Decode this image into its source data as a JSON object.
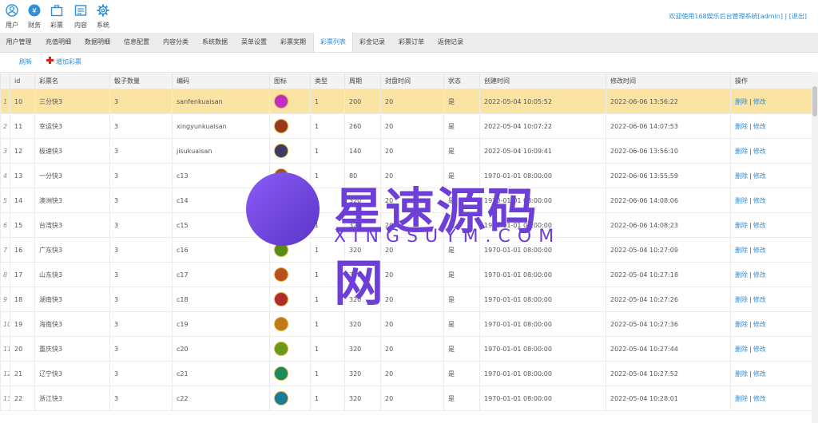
{
  "top_nav": [
    {
      "label": "用户",
      "icon": "user-icon"
    },
    {
      "label": "财务",
      "icon": "yen-icon"
    },
    {
      "label": "彩票",
      "icon": "briefcase-icon"
    },
    {
      "label": "内容",
      "icon": "document-icon"
    },
    {
      "label": "系统",
      "icon": "gear-icon"
    }
  ],
  "header": {
    "welcome": "欢迎使用168娱乐后台管理系统[admin]",
    "separator": "|",
    "logout": "[退出]"
  },
  "tabs": [
    "用户管理",
    "充值明细",
    "数据明细",
    "信息配置",
    "内容分类",
    "系统数据",
    "菜单设置",
    "彩票奖期",
    "彩票列表",
    "彩金记录",
    "彩票订单",
    "返佣记录"
  ],
  "active_tab": "彩票列表",
  "toolbar": {
    "refresh": "刷新",
    "add": "增加彩票"
  },
  "table": {
    "headers": [
      "",
      "id",
      "彩票名",
      "骰子数量",
      "编码",
      "图标",
      "类型",
      "周期",
      "封盘时间",
      "状态",
      "创建时间",
      "修改时间",
      "操作"
    ],
    "actions": {
      "delete": "删除",
      "sep": "|",
      "edit": "修改"
    },
    "rows": [
      {
        "n": "1",
        "id": "10",
        "name": "三分快3",
        "dice": "3",
        "code": "sanfenkuaisan",
        "type": "1",
        "period": "200",
        "close": "20",
        "status": "是",
        "created": "2022-05-04 10:05:52",
        "modified": "2022-06-06 13:56:22",
        "badge": "#c02fbf"
      },
      {
        "n": "2",
        "id": "11",
        "name": "幸运快3",
        "dice": "3",
        "code": "xingyunkuaisan",
        "type": "1",
        "period": "260",
        "close": "20",
        "status": "是",
        "created": "2022-05-04 10:07:22",
        "modified": "2022-06-06 14:07:53",
        "badge": "#9a3a1a"
      },
      {
        "n": "3",
        "id": "12",
        "name": "极速快3",
        "dice": "3",
        "code": "jisukuaisan",
        "type": "1",
        "period": "140",
        "close": "20",
        "status": "是",
        "created": "2022-05-04 10:09:41",
        "modified": "2022-06-06 13:56:10",
        "badge": "#3d3a66"
      },
      {
        "n": "4",
        "id": "13",
        "name": "一分快3",
        "dice": "3",
        "code": "c13",
        "type": "1",
        "period": "80",
        "close": "20",
        "status": "是",
        "created": "1970-01-01 08:00:00",
        "modified": "2022-06-06 13:55:59",
        "badge": "#a0521a"
      },
      {
        "n": "5",
        "id": "14",
        "name": "澳洲快3",
        "dice": "3",
        "code": "c14",
        "type": "1",
        "period": "320",
        "close": "20",
        "status": "是",
        "created": "1970-01-01 08:00:00",
        "modified": "2022-06-06 14:08:06",
        "badge": "#2a6a8a"
      },
      {
        "n": "6",
        "id": "15",
        "name": "台湾快3",
        "dice": "3",
        "code": "c15",
        "type": "1",
        "period": "320",
        "close": "20",
        "status": "是",
        "created": "1970-01-01 08:00:00",
        "modified": "2022-06-06 14:08:23",
        "badge": "#1a6a4a"
      },
      {
        "n": "7",
        "id": "16",
        "name": "广东快3",
        "dice": "3",
        "code": "c16",
        "type": "1",
        "period": "320",
        "close": "20",
        "status": "是",
        "created": "1970-01-01 08:00:00",
        "modified": "2022-05-04 10:27:09",
        "badge": "#5a8a1a"
      },
      {
        "n": "8",
        "id": "17",
        "name": "山东快3",
        "dice": "3",
        "code": "c17",
        "type": "1",
        "period": "320",
        "close": "20",
        "status": "是",
        "created": "1970-01-01 08:00:00",
        "modified": "2022-05-04 10:27:18",
        "badge": "#b8501a"
      },
      {
        "n": "9",
        "id": "18",
        "name": "湖南快3",
        "dice": "3",
        "code": "c18",
        "type": "1",
        "period": "320",
        "close": "20",
        "status": "是",
        "created": "1970-01-01 08:00:00",
        "modified": "2022-05-04 10:27:26",
        "badge": "#b02a2a"
      },
      {
        "n": "10",
        "id": "19",
        "name": "海南快3",
        "dice": "3",
        "code": "c19",
        "type": "1",
        "period": "320",
        "close": "20",
        "status": "是",
        "created": "1970-01-01 08:00:00",
        "modified": "2022-05-04 10:27:36",
        "badge": "#c07a1a"
      },
      {
        "n": "11",
        "id": "20",
        "name": "重庆快3",
        "dice": "3",
        "code": "c20",
        "type": "1",
        "period": "320",
        "close": "20",
        "status": "是",
        "created": "1970-01-01 08:00:00",
        "modified": "2022-05-04 10:27:44",
        "badge": "#6a9a1a"
      },
      {
        "n": "12",
        "id": "21",
        "name": "辽宁快3",
        "dice": "3",
        "code": "c21",
        "type": "1",
        "period": "320",
        "close": "20",
        "status": "是",
        "created": "1970-01-01 08:00:00",
        "modified": "2022-05-04 10:27:52",
        "badge": "#1a8a5a"
      },
      {
        "n": "13",
        "id": "22",
        "name": "浙江快3",
        "dice": "3",
        "code": "c22",
        "type": "1",
        "period": "320",
        "close": "20",
        "status": "是",
        "created": "1970-01-01 08:00:00",
        "modified": "2022-05-04 10:28:01",
        "badge": "#1a7a9a"
      }
    ]
  },
  "watermark": {
    "title": "星速源码网",
    "sub": "XINGSUYM.COM"
  }
}
